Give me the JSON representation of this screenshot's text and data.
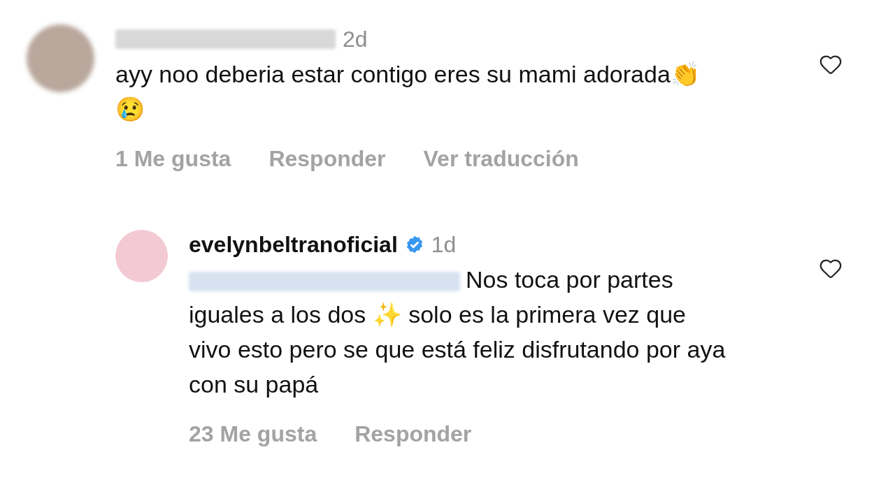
{
  "comments": [
    {
      "kind": "comment",
      "time": "2d",
      "text": "ayy noo deberia estar contigo eres su mami adorada👏 😢",
      "liked": false,
      "actions": [
        "1 Me gusta",
        "Responder",
        "Ver traducción"
      ]
    },
    {
      "kind": "reply",
      "username": "evelynbeltranoficial",
      "verified": true,
      "time": "1d",
      "text": "Nos toca por partes iguales a los dos ✨ solo es la primera vez que vivo esto pero se que está feliz disfrutando por aya con su papá",
      "liked": false,
      "actions": [
        "23 Me gusta",
        "Responder"
      ]
    }
  ]
}
